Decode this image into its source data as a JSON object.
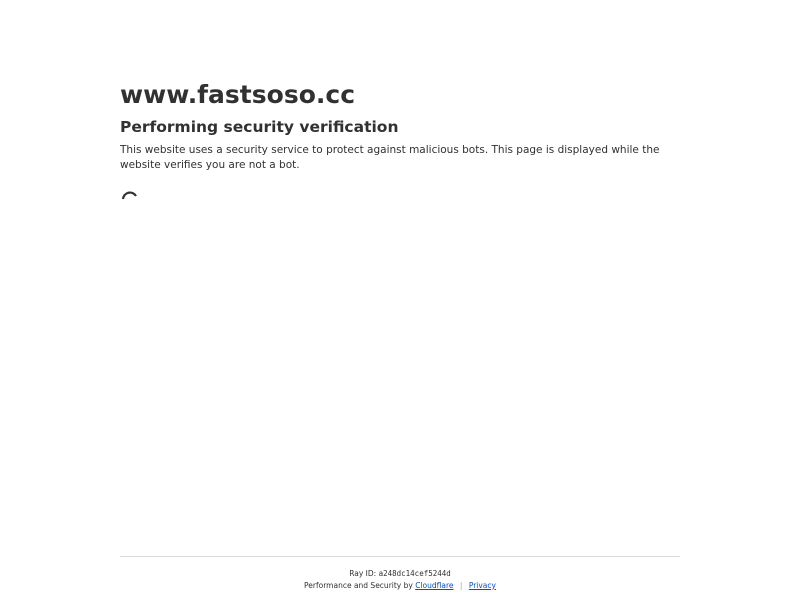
{
  "site": {
    "domain": "www.fastsoso.cc"
  },
  "main": {
    "heading": "Performing security verification",
    "description": "This website uses a security service to protect against malicious bots. This page is displayed while the website verifies you are not a bot."
  },
  "spinner": {
    "icon": "loading-spinner-icon"
  },
  "footer": {
    "ray_label": "Ray ID:",
    "ray_id": "a248dc14cef5244d",
    "performance_text": "Performance and Security by",
    "cloudflare_link": "Cloudflare",
    "separator": "|",
    "privacy_link": "Privacy"
  },
  "colors": {
    "text": "#313131",
    "link": "#0051c3",
    "divider": "#d9d9d9"
  }
}
